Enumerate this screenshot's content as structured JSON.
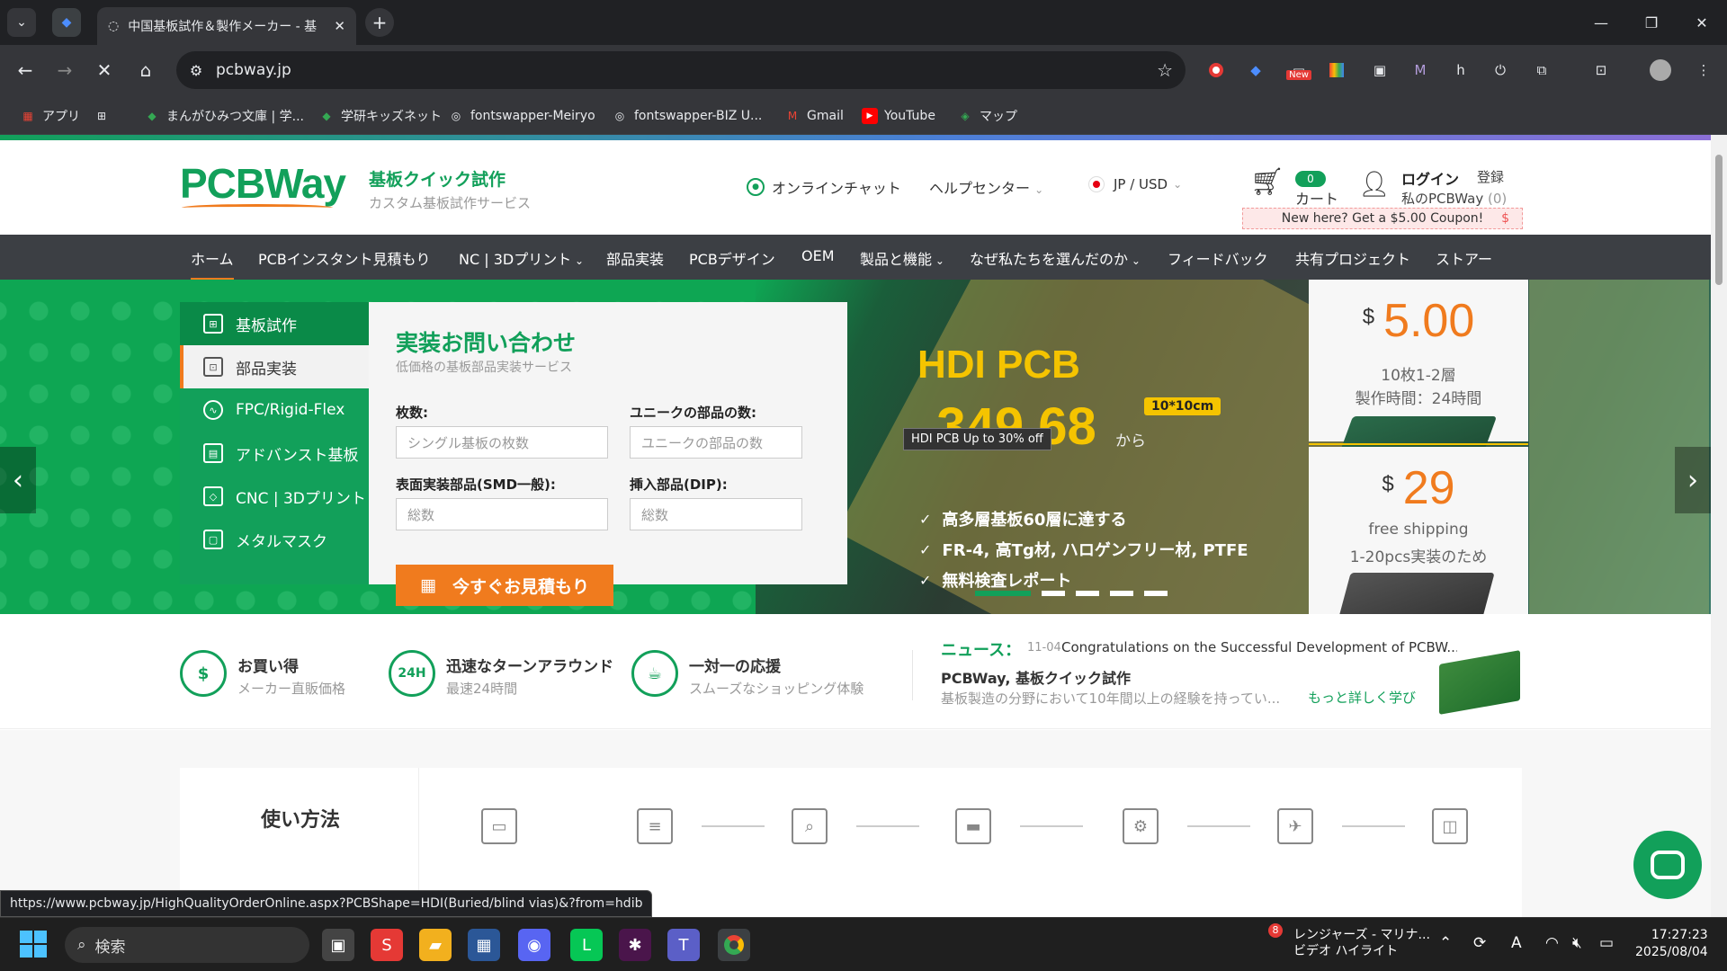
{
  "browser": {
    "tab_title": "中国基板試作＆製作メーカー - 基",
    "url": "pcbway.jp",
    "bookmarks": [
      "アプリ",
      "まんがひみつ文庫 | 学...",
      "学研キッズネット",
      "fontswapper-Meiryo",
      "fontswapper-BIZ U...",
      "Gmail",
      "YouTube",
      "マップ"
    ],
    "extension_badge": "New",
    "status_url": "https://www.pcbway.jp/HighQualityOrderOnline.aspx?PCBShape=HDI(Buried/blind vias)&?from=hdib"
  },
  "header": {
    "logo": "PCBWay",
    "tagline_title": "基板クイック試作",
    "tagline_sub": "カスタム基板試作サービス",
    "chat": "オンラインチャット",
    "help": "ヘルプセンター",
    "lang": "JP / USD",
    "cart_count": "0",
    "cart_label": "カート",
    "login": "ログイン",
    "register": "登録",
    "my_pcbway": "私のPCBWay",
    "my_count": "(0)",
    "coupon": "New here? Get a $5.00 Coupon!",
    "coupon_symbol": "$"
  },
  "nav": [
    "ホーム",
    "PCBインスタント見積もり",
    "NC | 3Dプリント",
    "部品実装",
    "PCBデザイン",
    "OEM",
    "製品と機能",
    "なぜ私たちを選んだのか",
    "フィードバック",
    "共有プロジェクト",
    "ストアー"
  ],
  "sidemenu": [
    "基板試作",
    "部品実装",
    "FPC/Rigid-Flex",
    "アドバンスト基板",
    "CNC | 3Dプリント",
    "メタルマスク"
  ],
  "form": {
    "title": "実装お問い合わせ",
    "subtitle": "低価格の基板部品実装サービス",
    "qty_label": "枚数:",
    "qty_placeholder": "シングル基板の枚数",
    "unique_label": "ユニークの部品の数:",
    "unique_placeholder": "ユニークの部品の数",
    "smd_label": "表面実装部品(SMD一般):",
    "smd_placeholder": "総数",
    "dip_label": "挿入部品(DIP):",
    "dip_placeholder": "総数",
    "button": "今すぐお見積もり"
  },
  "hero": {
    "title": "HDI PCB",
    "currency": "$",
    "price": "349.68",
    "from": "から",
    "size": "10*10cm",
    "tooltip": "HDI PCB Up to 30% off",
    "features": [
      "高多層基板60層に達する",
      "FR-4, 高Tg材, ハロゲンフリー材, PTFE",
      "無料検査レポート"
    ]
  },
  "promo1": {
    "currency": "$",
    "price": "5.00",
    "line1": "10枚1-2層",
    "line2": "製作時間：24時間"
  },
  "promo2": {
    "currency": "$",
    "price": "29",
    "line1": "free shipping",
    "line2": "1-20pcs実装のため"
  },
  "features": [
    {
      "title": "お買い得",
      "sub": "メーカー直販価格",
      "icon": "$"
    },
    {
      "title": "迅速なターンアラウンド",
      "sub": "最速24時間",
      "icon": "24H"
    },
    {
      "title": "一対一の応援",
      "sub": "スムーズなショッピング体験",
      "icon": "☕"
    }
  ],
  "news": {
    "label": "ニュース：",
    "date": "11-04",
    "headline": "Congratulations on the Successful Development of PCBW...",
    "title": "PCBWay, 基板クイック試作",
    "desc": "基板製造の分野において10年間以上の経験を持ってい...",
    "more": "もっと詳しく学び"
  },
  "howto": {
    "title": "使い方法"
  },
  "taskbar": {
    "search": "検索",
    "notif_count": "8",
    "notif_title": "レンジャーズ - マリナ...",
    "notif_sub": "ビデオ ハイライト",
    "time": "17:27:23",
    "date": "2025/08/04",
    "ime": "A"
  },
  "colors": {
    "brand_green": "#12a05a",
    "accent_orange": "#f07b1e",
    "price_yellow": "#f5c400"
  }
}
